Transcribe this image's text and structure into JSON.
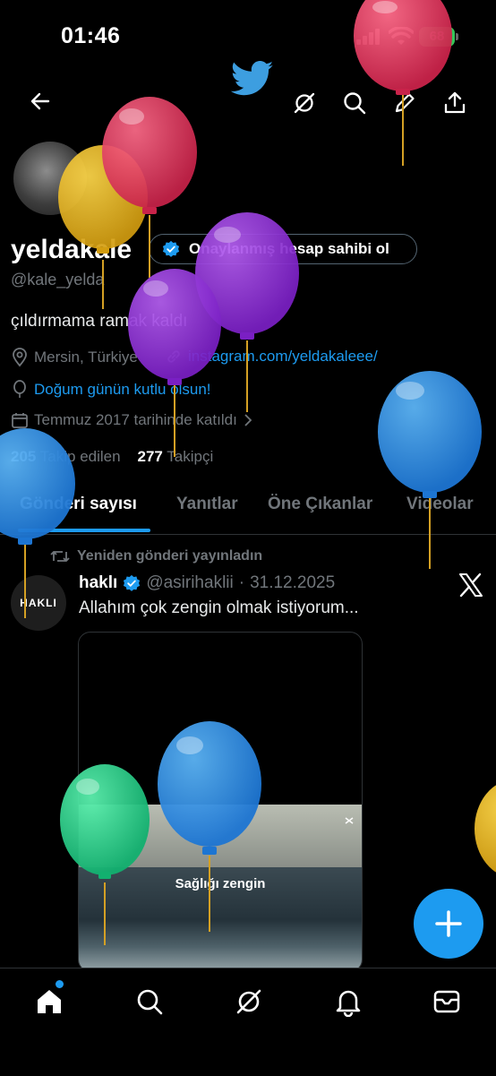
{
  "status_bar": {
    "time": "01:46",
    "battery": "68"
  },
  "header": {
    "back_icon": "arrow-left-icon",
    "logo_icon": "twitter-bird-icon",
    "grok_icon": "grok-icon",
    "search_icon": "search-icon",
    "edit_icon": "pencil-icon",
    "share_icon": "share-icon"
  },
  "profile": {
    "display_name": "yeldakale",
    "verify_button_label": "Onaylanmış hesap sahibi ol",
    "handle": "@kale_yelda",
    "bio": "çıldırmama ramak kaldı",
    "location": "Mersin, Türkiye",
    "website": "instagram.com/yeldakaleee/",
    "birthday_text": "Doğum günün kutlu olsun!",
    "joined": "Temmuz 2017 tarihinde katıldı",
    "following_count": "205",
    "following_label": "Takip edilen",
    "followers_count": "277",
    "followers_label": "Takipçi"
  },
  "tabs": [
    "Gönderi sayısı",
    "Yanıtlar",
    "Öne Çıkanlar",
    "Videolar"
  ],
  "active_tab": "Gönderi sayısı",
  "tweet": {
    "repost_label": "Yeniden gönderi yayınladın",
    "avatar_text": "HAKLI",
    "author_name": "haklı",
    "author_handle": "@asirihaklii",
    "separator": "·",
    "date": "31.12.2025",
    "text": "Allahım çok zengin olmak istiyorum...",
    "media_caption": "Sağlığı zengin"
  },
  "fab_label": "+",
  "bottom_nav": [
    "home-icon",
    "search-icon",
    "grok-icon",
    "bell-icon",
    "mail-icon"
  ],
  "colors": {
    "accent": "#1d9bf0",
    "background": "#000000",
    "text_secondary": "#71767b",
    "balloon_red": "#e0335a",
    "balloon_yellow": "#e8b81c",
    "balloon_purple": "#8e2fd6",
    "balloon_blue": "#2a8ae0",
    "balloon_green": "#1fcf86"
  }
}
